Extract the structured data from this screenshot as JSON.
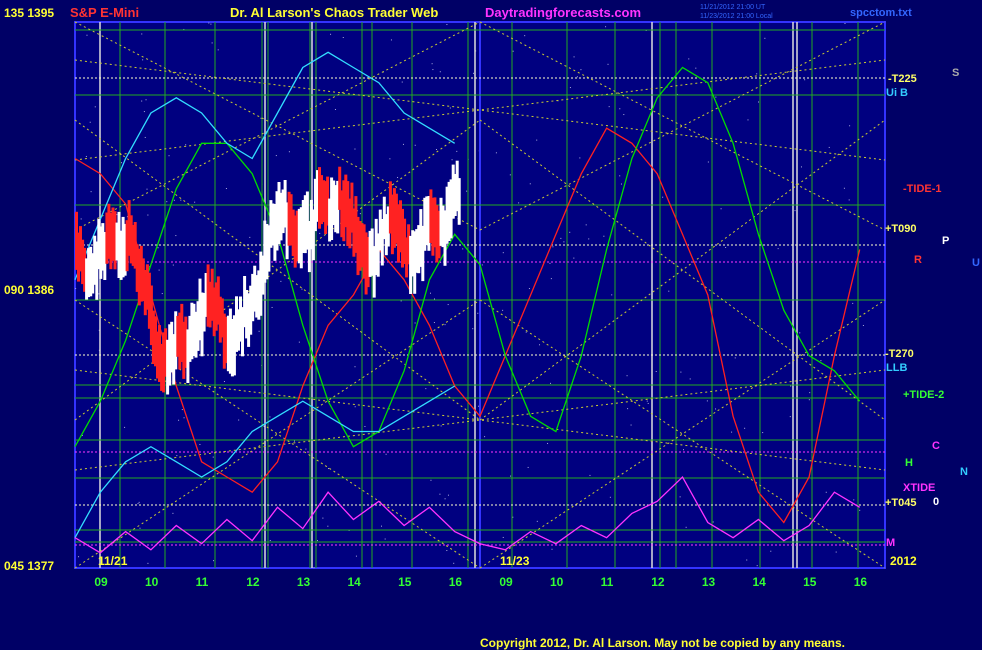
{
  "header": {
    "instrument": "S&P E-Mini",
    "title": "Dr. Al Larson's Chaos Trader Web",
    "site": "Daytradingforecasts.com",
    "timestamp1": "11/21/2012 21:00 UT",
    "timestamp2": "11/23/2012 21:00 Local",
    "file": "spcctom.txt",
    "left_top": "135 1395",
    "left_mid": "090 1386",
    "left_bot": "045 1377"
  },
  "footer": {
    "copyright": "Copyright 2012, Dr. Al Larson. May not be copied by any means.",
    "date_left": "11/21",
    "date_mid": "11/23",
    "year": "2012"
  },
  "right_labels": {
    "t225": "-T225",
    "uib": "Ui B",
    "tide1": "-TIDE-1",
    "t090": "+T090",
    "t270": "-T270",
    "llb": "LLB",
    "tide2": "+TIDE-2",
    "xtide": "XTIDE",
    "t045": "+T045",
    "m": "M",
    "s": "S",
    "p": "P",
    "r": "R",
    "u": "U",
    "c": "C",
    "h": "H",
    "n": "N",
    "o": "0"
  },
  "chart_data": {
    "type": "line",
    "xlabel": "",
    "ylabel": "",
    "ylim": [
      1377,
      1395
    ],
    "hours_day1": [
      "09",
      "10",
      "11",
      "12",
      "13",
      "14",
      "15",
      "16"
    ],
    "hours_day2": [
      "09",
      "10",
      "11",
      "12",
      "13",
      "14",
      "15",
      "16"
    ],
    "price_series": {
      "name": "",
      "x": [
        8.5,
        8.7,
        8.9,
        9.1,
        9.3,
        9.5,
        9.7,
        9.9,
        10.1,
        10.3,
        10.5,
        10.7,
        10.9,
        11.1,
        11.3,
        11.5,
        11.7,
        11.9,
        12.1,
        12.3,
        12.5,
        12.7,
        12.9,
        13.1,
        13.3,
        13.5,
        13.7,
        13.9,
        14.1,
        14.3,
        14.5,
        14.7,
        14.9,
        15.1,
        15.3,
        15.5,
        15.7,
        15.9,
        16.1
      ],
      "y": [
        1387.5,
        1386.8,
        1387.2,
        1387.9,
        1387.4,
        1388.1,
        1387.0,
        1386.3,
        1384.2,
        1383.6,
        1384.8,
        1384.1,
        1385.0,
        1386.1,
        1385.6,
        1384.4,
        1384.8,
        1385.5,
        1386.0,
        1387.8,
        1388.4,
        1388.6,
        1388.0,
        1388.2,
        1389.0,
        1388.7,
        1389.2,
        1388.6,
        1387.6,
        1387.0,
        1387.8,
        1388.6,
        1388.0,
        1387.2,
        1387.6,
        1388.4,
        1388.0,
        1388.9,
        1389.5
      ]
    },
    "lines": [
      {
        "name": "",
        "color": "#ff2020",
        "x": [
          8.5,
          9.0,
          9.5,
          10.0,
          10.5,
          11.0,
          11.5,
          12.0,
          12.5,
          13.0,
          13.5,
          14.0,
          14.5,
          15.0,
          15.5,
          16.0,
          16.5,
          17.0,
          17.5,
          18.0,
          18.5,
          19.0,
          19.5,
          20.0,
          20.5,
          21.0,
          21.5,
          22.0,
          22.5,
          23.0,
          23.5,
          24.0
        ],
        "y": [
          1390.5,
          1390.0,
          1389.0,
          1386.0,
          1383.0,
          1380.5,
          1380.0,
          1379.5,
          1380.5,
          1383.0,
          1385.0,
          1386.0,
          1387.5,
          1386.5,
          1385.0,
          1383.0,
          1382.0,
          1384.0,
          1386.0,
          1388.0,
          1390.0,
          1391.5,
          1391.0,
          1390.0,
          1388.0,
          1386.0,
          1382.0,
          1379.5,
          1378.5,
          1380.0,
          1384.0,
          1387.5
        ]
      },
      {
        "name": "",
        "color": "#00dd00",
        "x": [
          8.5,
          9.0,
          9.5,
          10.0,
          10.5,
          11.0,
          11.5,
          12.0,
          12.5,
          13.0,
          13.5,
          14.0,
          14.5,
          15.0,
          15.5,
          16.0,
          16.5,
          17.0,
          17.5,
          18.0,
          18.5,
          19.0,
          19.5,
          20.0,
          20.5,
          21.0,
          21.5,
          22.0,
          22.5,
          23.0,
          23.5,
          24.0
        ],
        "y": [
          1381.0,
          1382.5,
          1384.5,
          1387.0,
          1389.5,
          1391.0,
          1391.0,
          1390.0,
          1388.0,
          1385.0,
          1382.5,
          1381.0,
          1381.5,
          1383.5,
          1386.5,
          1388.0,
          1387.0,
          1384.0,
          1382.0,
          1381.5,
          1384.0,
          1387.5,
          1390.5,
          1392.5,
          1393.5,
          1393.0,
          1391.0,
          1388.0,
          1385.5,
          1384.0,
          1383.5,
          1382.5
        ]
      },
      {
        "name": "",
        "color": "#33ddff",
        "x": [
          8.5,
          9.0,
          9.5,
          10.0,
          10.5,
          11.0,
          11.5,
          12.0,
          12.5,
          13.0,
          13.5,
          14.0,
          14.5,
          15.0,
          15.5,
          16.0
        ],
        "y": [
          1386.5,
          1388.5,
          1390.5,
          1392.0,
          1392.5,
          1392.0,
          1391.0,
          1390.5,
          1392.0,
          1393.5,
          1394.0,
          1393.5,
          1393.0,
          1392.0,
          1391.5,
          1391.0
        ]
      },
      {
        "name": "",
        "color": "#33ddff",
        "x": [
          8.5,
          9.0,
          9.5,
          10.0,
          10.5,
          11.0,
          11.5,
          12.0,
          12.5,
          13.0,
          13.5,
          14.0,
          14.5,
          15.0,
          15.5,
          16.0
        ],
        "y": [
          1378.0,
          1379.5,
          1380.5,
          1381.0,
          1380.5,
          1380.0,
          1380.5,
          1381.5,
          1382.0,
          1382.5,
          1382.0,
          1381.5,
          1381.5,
          1382.0,
          1382.5,
          1383.0
        ]
      },
      {
        "name": "",
        "color": "#ff33ff",
        "x": [
          8.5,
          9.0,
          9.5,
          10.0,
          10.5,
          11.0,
          11.5,
          12.0,
          12.5,
          13.0,
          13.5,
          14.0,
          14.5,
          15.0,
          15.5,
          16.0,
          16.5,
          17.0,
          17.5,
          18.0,
          18.5,
          19.0,
          19.5,
          20.0,
          20.5,
          21.0,
          21.5,
          22.0,
          22.5,
          23.0,
          23.5,
          24.0
        ],
        "y": [
          1378.0,
          1377.5,
          1378.2,
          1377.6,
          1378.4,
          1377.8,
          1378.6,
          1377.9,
          1379.0,
          1378.3,
          1379.5,
          1378.6,
          1379.2,
          1378.4,
          1379.0,
          1378.2,
          1377.8,
          1377.6,
          1378.2,
          1377.8,
          1378.4,
          1378.0,
          1378.8,
          1379.2,
          1380.0,
          1378.5,
          1378.0,
          1378.6,
          1377.9,
          1378.4,
          1379.5,
          1379.0
        ]
      }
    ]
  }
}
